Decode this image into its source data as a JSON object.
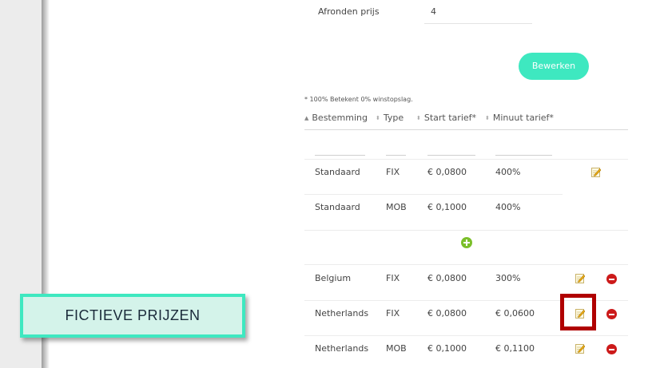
{
  "settings": {
    "afronden_label": "Afronden prijs",
    "afronden_value": "4",
    "bewerken_label": "Bewerken"
  },
  "note": "* 100% Betekent 0% winstopslag.",
  "table": {
    "headers": [
      "Bestemming",
      "Type",
      "Start tarief*",
      "Minuut tarief*"
    ],
    "default_rows": [
      {
        "bestemming": "Standaard",
        "type": "FIX",
        "start": "€ 0,0800",
        "minuut": "400%"
      },
      {
        "bestemming": "Standaard",
        "type": "MOB",
        "start": "€ 0,1000",
        "minuut": "400%"
      }
    ],
    "rows": [
      {
        "bestemming": "Belgium",
        "type": "FIX",
        "start": "€ 0,0800",
        "minuut": "300%"
      },
      {
        "bestemming": "Netherlands",
        "type": "FIX",
        "start": "€ 0,0800",
        "minuut": "€ 0,0600"
      },
      {
        "bestemming": "Netherlands",
        "type": "MOB",
        "start": "€ 0,1000",
        "minuut": "€ 0,1100"
      }
    ]
  },
  "callout_label": "FICTIEVE PRIJZEN",
  "icons": {
    "edit": "pencil-edit-icon",
    "delete": "minus-circle-icon",
    "add": "plus-circle-icon",
    "sort": "sort-arrows-icon"
  },
  "colors": {
    "accent": "#3ee8c0",
    "add_green": "#7bbf2a",
    "delete_red": "#cc1a1a",
    "highlight_red": "#b00000",
    "callout_bg": "#d4f3ea"
  }
}
